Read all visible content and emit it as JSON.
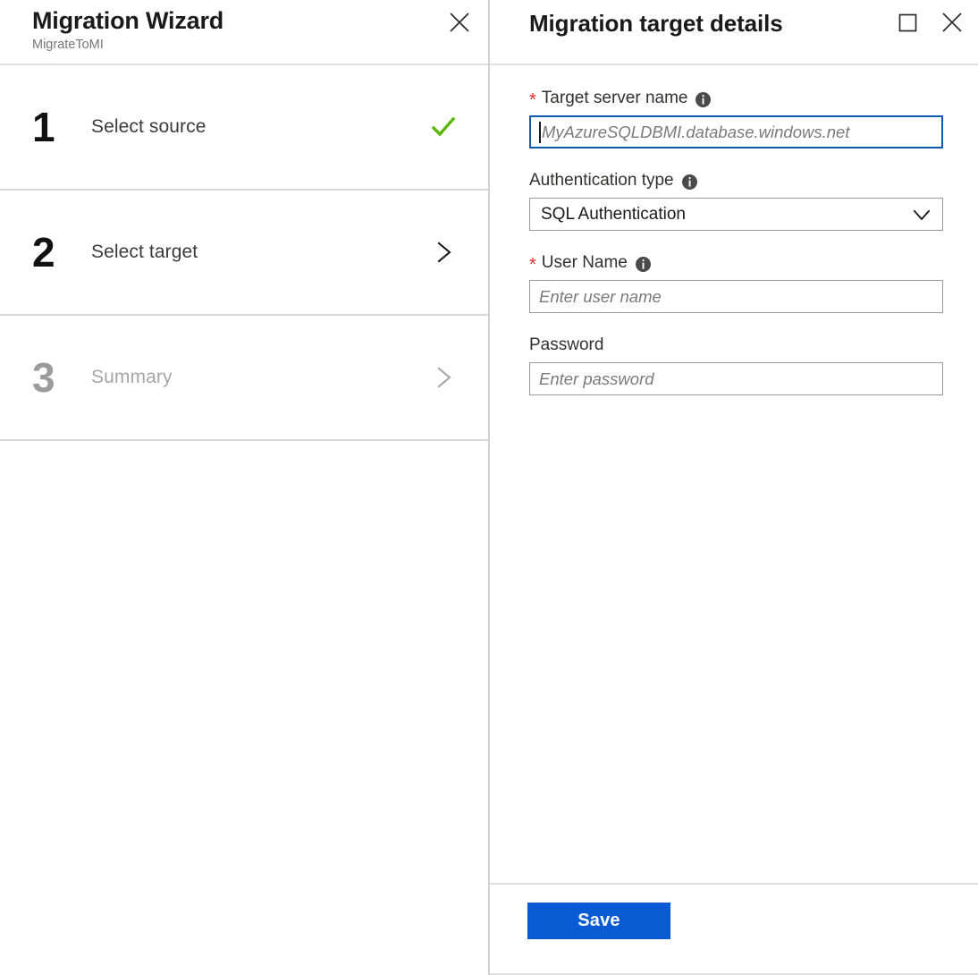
{
  "wizard": {
    "title": "Migration Wizard",
    "subtitle": "MigrateToMI",
    "close_icon": "close-icon",
    "steps": [
      {
        "number": "1",
        "label": "Select source",
        "status": "complete",
        "status_icon": "checkmark-icon"
      },
      {
        "number": "2",
        "label": "Select target",
        "status": "active",
        "status_icon": "chevron-right-icon"
      },
      {
        "number": "3",
        "label": "Summary",
        "status": "disabled",
        "status_icon": "chevron-right-icon"
      }
    ]
  },
  "details": {
    "title": "Migration target details",
    "maximize_icon": "maximize-icon",
    "close_icon": "close-icon",
    "fields": {
      "target_server": {
        "label": "Target server name",
        "required": true,
        "required_marker": "*",
        "info_icon": "info-icon",
        "placeholder": "MyAzureSQLDBMI.database.windows.net",
        "value": "",
        "focused": true
      },
      "auth_type": {
        "label": "Authentication type",
        "required": false,
        "info_icon": "info-icon",
        "selected": "SQL Authentication",
        "chevron_icon": "chevron-down-icon"
      },
      "user_name": {
        "label": "User Name",
        "required": true,
        "required_marker": "*",
        "info_icon": "info-icon",
        "placeholder": "Enter user name",
        "value": ""
      },
      "password": {
        "label": "Password",
        "required": false,
        "placeholder": "Enter password",
        "value": ""
      }
    },
    "footer": {
      "save_label": "Save"
    }
  },
  "colors": {
    "accent": "#0a5ad4",
    "success": "#5cb70b",
    "required": "#d63030",
    "focus_border": "#0f5cad",
    "border": "#9b9b9b"
  }
}
